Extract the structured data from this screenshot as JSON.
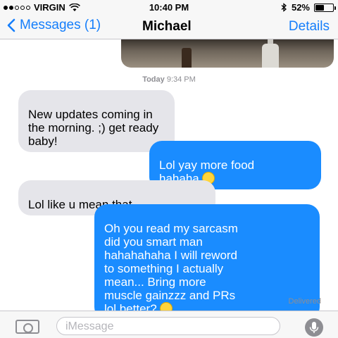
{
  "status_bar": {
    "carrier": "VIRGIN",
    "time": "10:40 PM",
    "battery_percent": "52%",
    "battery_level": 0.52,
    "signal_bars_filled": 2,
    "signal_bars_total": 5,
    "icons": [
      "wifi-icon",
      "bluetooth-icon",
      "battery-icon"
    ]
  },
  "nav": {
    "back_label": "Messages (1)",
    "title": "Michael",
    "details_label": "Details"
  },
  "conversation": {
    "timestamp_day": "Today",
    "timestamp_time": "9:34 PM",
    "messages": [
      {
        "direction": "incoming",
        "text": "New updates coming in\nthe morning. ;) get ready\nbaby!"
      },
      {
        "direction": "outgoing",
        "text": "Lol yay more food\nhahaha",
        "emoji": "winking-tongue-emoji"
      },
      {
        "direction": "incoming",
        "text": "Lol like u mean that..."
      },
      {
        "direction": "outgoing",
        "text": "Oh you read my sarcasm\ndid you smart man\nhahahahaha I will reword\nto something I actually\nmean... Bring more\nmuscle gainzzz and PRs\nlol better?",
        "emoji": "grimacing-emoji"
      }
    ],
    "delivered_label": "Delivered"
  },
  "input": {
    "placeholder": "iMessage"
  },
  "colors": {
    "accent": "#157efb",
    "outgoing_bubble": "#1a8cff",
    "incoming_bubble": "#e5e5ea"
  }
}
